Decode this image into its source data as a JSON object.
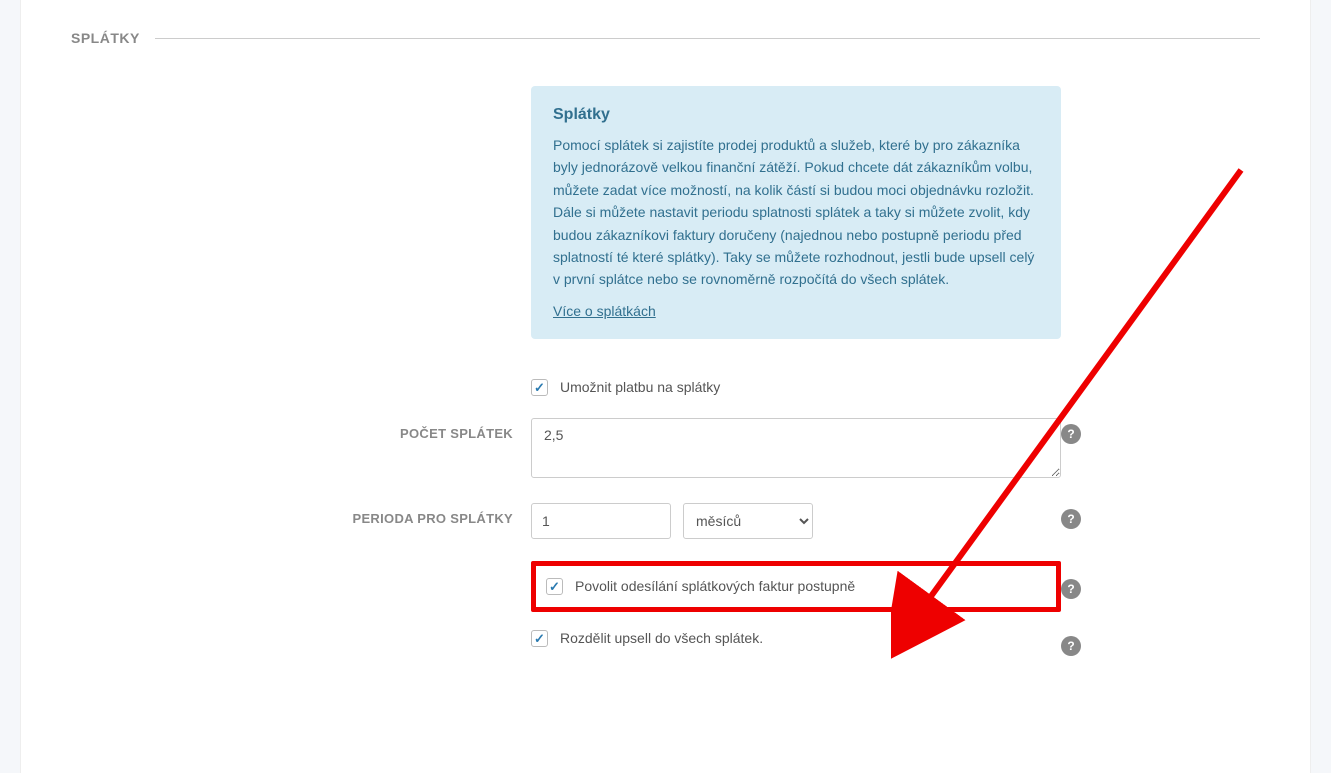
{
  "section": {
    "title": "SPLÁTKY"
  },
  "info": {
    "title": "Splátky",
    "text": "Pomocí splátek si zajistíte prodej produktů a služeb, které by pro zákazníka byly jednorázově velkou finanční zátěží. Pokud chcete dát zákazníkům volbu, můžete zadat více možností, na kolik částí si budou moci objednávku rozložit. Dále si můžete nastavit periodu splatnosti splátek a taky si můžete zvolit, kdy budou zákazníkovi faktury doručeny (najednou nebo postupně periodu před splatností té které splátky). Taky se můžete rozhodnout, jestli bude upsell celý v první splátce nebo se rovnoměrně rozpočítá do všech splátek.",
    "link": "Více o splátkách"
  },
  "enable": {
    "label": "Umožnit platbu na splátky"
  },
  "count": {
    "label": "POČET SPLÁTEK",
    "value": "2,5"
  },
  "period": {
    "label": "PERIODA PRO SPLÁTKY",
    "value": "1",
    "unit": "měsíců"
  },
  "gradual": {
    "label": "Povolit odesílání splátkových faktur postupně"
  },
  "upsell": {
    "label": "Rozdělit upsell do všech splátek."
  },
  "help_glyph": "?"
}
